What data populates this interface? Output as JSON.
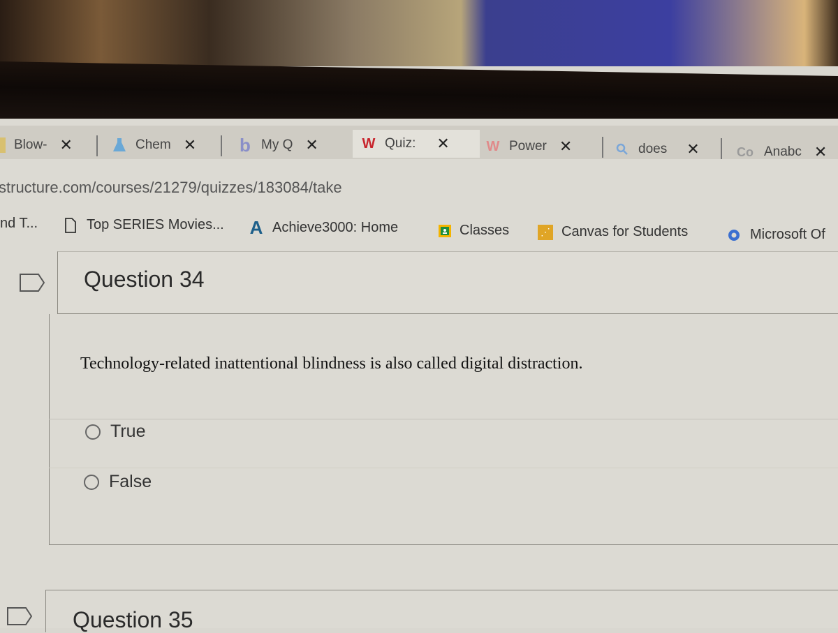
{
  "browser": {
    "tabs": [
      {
        "label": "Blow-",
        "icon": "page-icon",
        "active": false
      },
      {
        "label": "Chem",
        "icon": "flask-icon",
        "active": false
      },
      {
        "label": "My Q",
        "icon": "bartleby-icon",
        "active": false
      },
      {
        "label": "Quiz:",
        "icon": "w-logo-icon",
        "active": true
      },
      {
        "label": "Power",
        "icon": "w-logo-icon",
        "active": false
      },
      {
        "label": "does",
        "icon": "search-icon",
        "active": false
      },
      {
        "label": "Anabc",
        "icon": "course-hero-icon",
        "active": false
      }
    ],
    "close_glyph": "✕",
    "url": "structure.com/courses/21279/quizzes/183084/take",
    "bookmarks": [
      {
        "label": "nd T...",
        "icon": ""
      },
      {
        "label": "Top SERIES Movies...",
        "icon": "document-icon"
      },
      {
        "label": "Achieve3000: Home",
        "icon": "achieve-icon"
      },
      {
        "label": "Classes",
        "icon": "classroom-icon"
      },
      {
        "label": "Canvas for Students",
        "icon": "canvas-icon"
      },
      {
        "label": "Microsoft Of",
        "icon": "microsoft-office-icon"
      }
    ]
  },
  "quiz": {
    "question_34": {
      "title": "Question 34",
      "text": "Technology-related inattentional blindness is also called digital distraction.",
      "answers": [
        {
          "label": "True",
          "selected": false
        },
        {
          "label": "False",
          "selected": false
        }
      ]
    },
    "question_35": {
      "title": "Question 35"
    }
  },
  "colors": {
    "w_logo": "#c8242c",
    "achieve": "#1d5f8a",
    "classroom": "#1e8e3e",
    "classroom_bg": "#f4b400",
    "canvas_bg": "#e0a526",
    "search_icon": "#7aa6d8",
    "bartleby": "#8a8fc8",
    "flask": "#6aa8d6"
  }
}
